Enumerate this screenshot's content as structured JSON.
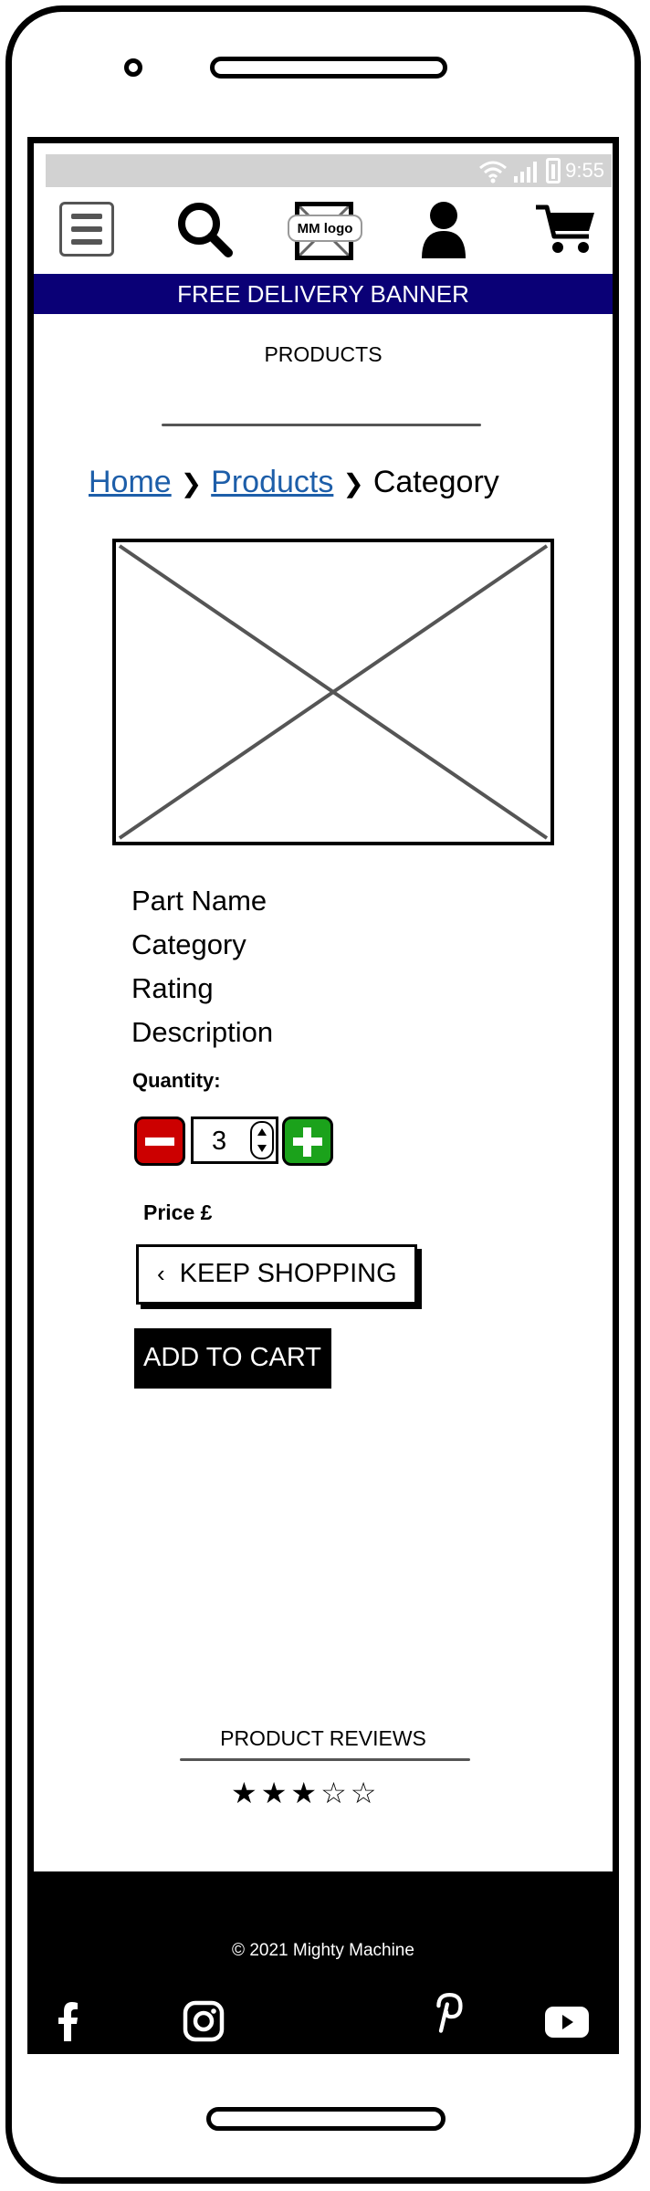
{
  "status_bar": {
    "time": "9:55"
  },
  "header": {
    "logo_text": "MM logo",
    "icons": [
      "menu-icon",
      "search-icon",
      "user-icon",
      "cart-icon"
    ]
  },
  "banner": {
    "text": "FREE DELIVERY BANNER"
  },
  "page": {
    "title": "PRODUCTS"
  },
  "breadcrumb": {
    "home": "Home",
    "products": "Products",
    "current": "Category",
    "separator": "❯"
  },
  "product": {
    "part_name": "Part Name",
    "category": "Category",
    "rating": "Rating",
    "description": "Description",
    "quantity_label": "Quantity:",
    "quantity_value": "3",
    "price_label": "Price £"
  },
  "actions": {
    "keep_shopping": "KEEP SHOPPING",
    "add_to_cart": "ADD TO CART"
  },
  "reviews": {
    "title": "PRODUCT REVIEWS",
    "stars": "★★★☆☆",
    "rating": 3,
    "max_rating": 5
  },
  "footer": {
    "copyright": "2021 Mighty Machine",
    "social_icons": [
      "facebook-icon",
      "instagram-icon",
      "pinterest-icon",
      "youtube-icon"
    ]
  },
  "colors": {
    "banner": "#0a0076",
    "link": "#1d5ea9",
    "minus_button": "#cc0000",
    "plus_button": "#1ba21b",
    "footer": "#000000"
  }
}
